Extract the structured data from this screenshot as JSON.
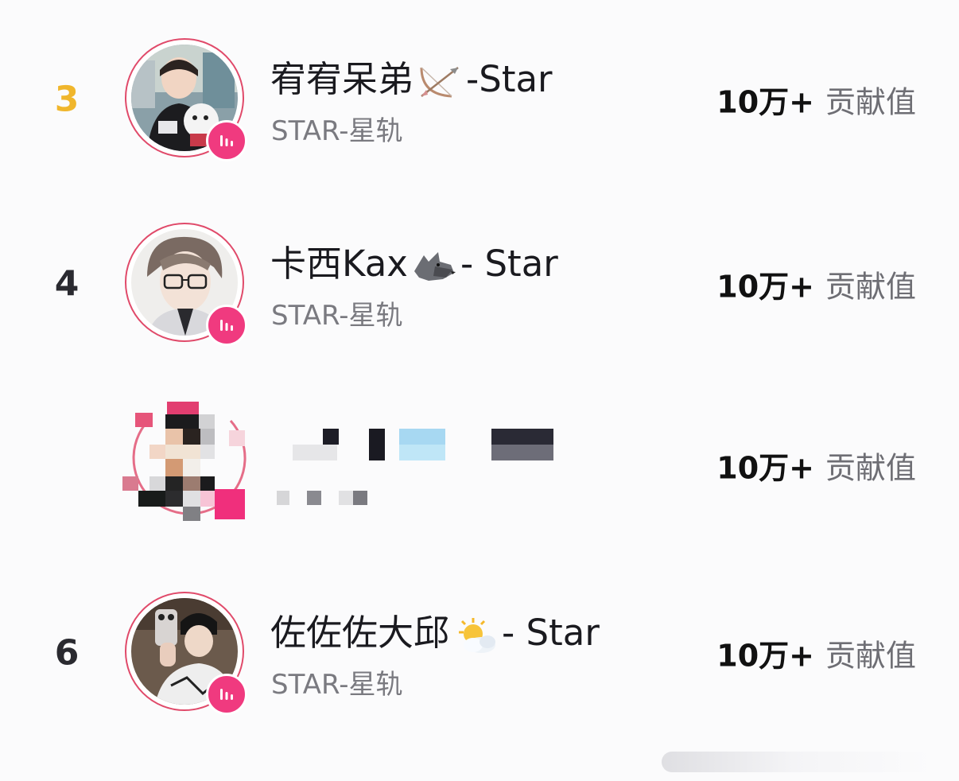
{
  "leaderboard": {
    "rows": [
      {
        "rank": "3",
        "rank_color": "#f0b62c",
        "name_text": "宥宥呆弟",
        "name_emoji": "bow-and-arrow-icon",
        "name_suffix": "-Star",
        "group": "STAR-星轨",
        "score": "10万+",
        "score_label": "贡献值"
      },
      {
        "rank": "4",
        "rank_color": "#2a2a30",
        "name_text": "卡西Kax",
        "name_emoji": "wolf-icon",
        "name_suffix": "- Star",
        "group": "STAR-星轨",
        "score": "10万+",
        "score_label": "贡献值"
      },
      {
        "rank": "",
        "name_text": "",
        "group": "",
        "score": "10万+",
        "score_label": "贡献值",
        "obscured": true
      },
      {
        "rank": "6",
        "rank_color": "#2a2a30",
        "name_text": "佐佐佐大邱",
        "name_emoji": "sun-behind-cloud-icon",
        "name_suffix": "- Star",
        "group": "STAR-星轨",
        "score": "10万+",
        "score_label": "贡献值"
      }
    ]
  },
  "colors": {
    "ring": "#e04a6a",
    "live_badge": "#f03a7f",
    "rank_gold": "#f0b62c"
  }
}
